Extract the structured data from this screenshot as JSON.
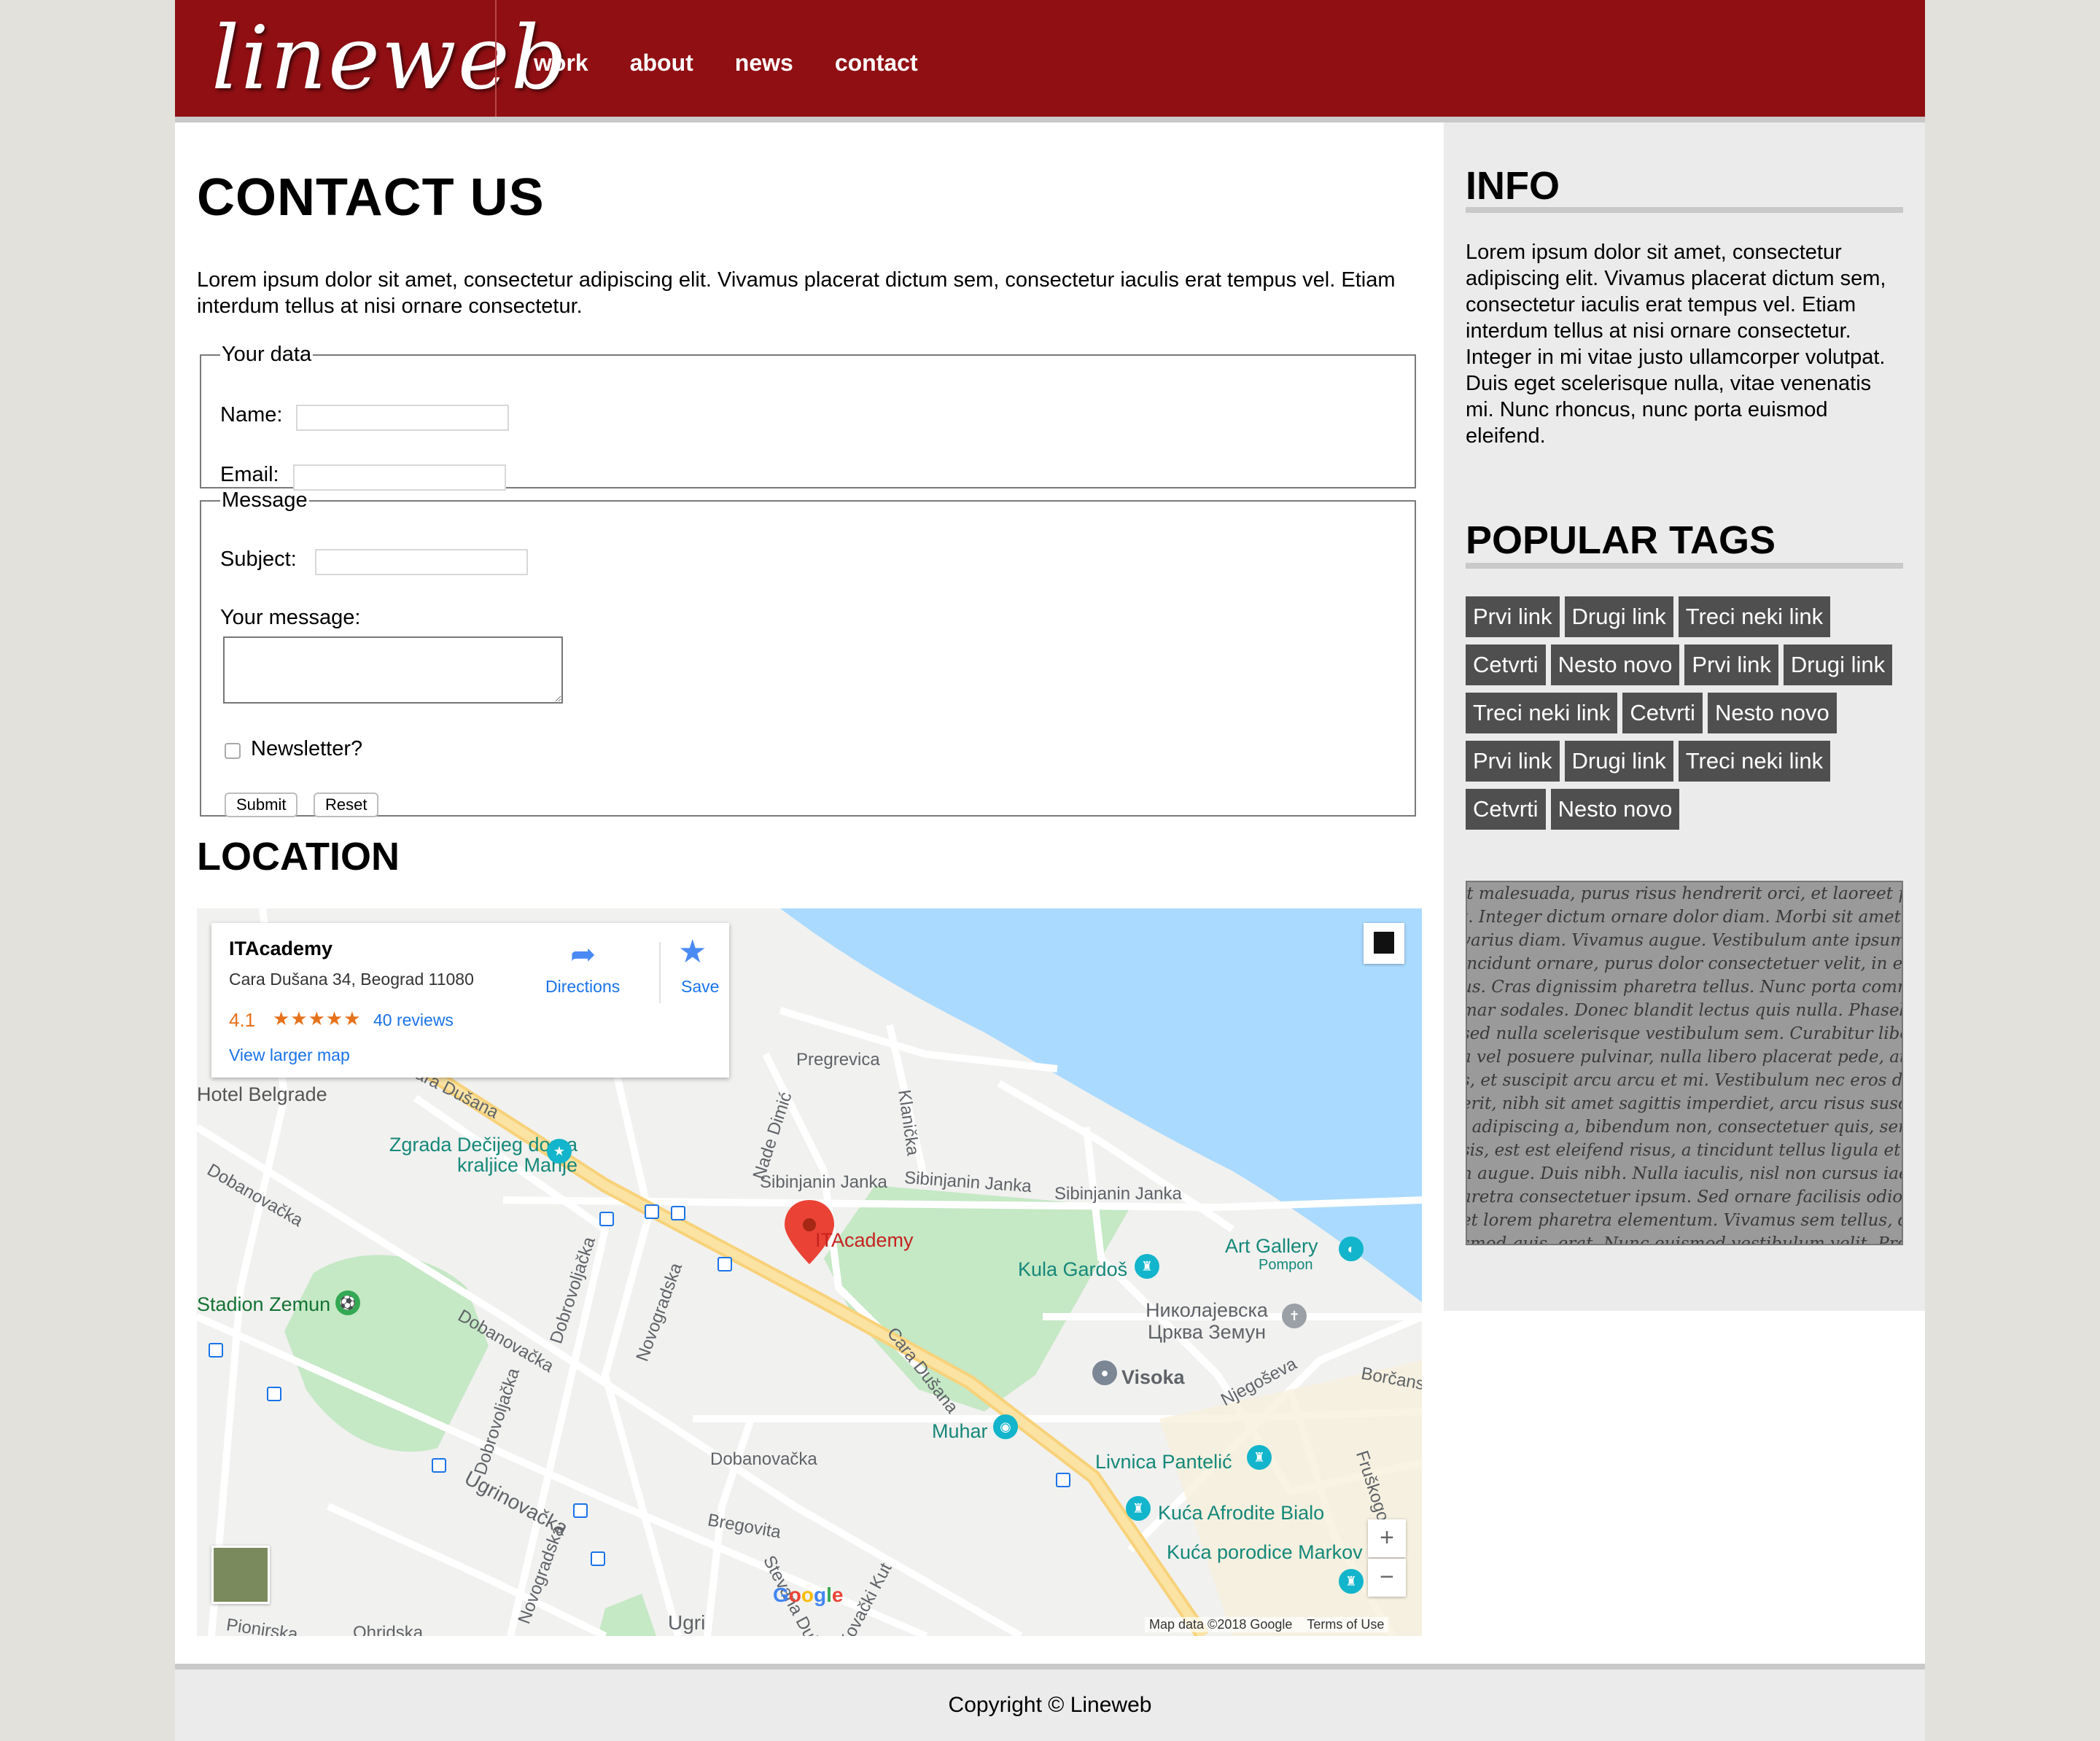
{
  "header": {
    "logo": "lineweb",
    "nav": [
      "work",
      "about",
      "news",
      "contact"
    ],
    "brand_color": "#8f0f13"
  },
  "main": {
    "title": "CONTACT US",
    "intro": "Lorem ipsum dolor sit amet, consectetur adipiscing elit. Vivamus placerat dictum sem, consectetur iaculis erat tempus vel. Etiam interdum tellus at nisi ornare consectetur.",
    "form": {
      "fieldset_data": "Your data",
      "name_label": "Name:",
      "email_label": "Email:",
      "fieldset_message": "Message",
      "subject_label": "Subject:",
      "message_label": "Your message:",
      "newsletter_label": "Newsletter?",
      "newsletter_checked": false,
      "submit_label": "Submit",
      "reset_label": "Reset"
    },
    "location_title": "LOCATION"
  },
  "map": {
    "place_name": "ITAcademy",
    "address": "Cara Dušana 34, Beograd 11080",
    "rating": "4.1",
    "stars": "★★★★★",
    "reviews": "40 reviews",
    "view_larger": "View larger map",
    "directions": "Directions",
    "save": "Save",
    "marker_label": "ITAcademy",
    "streets": [
      "Pregrevica",
      "Cara Dušana",
      "Cara Dušana",
      "Nade Dimić",
      "Klanička",
      "Sibinjanin Janka",
      "Sibinjanin Janka",
      "Sibinjanin Janka",
      "Dobanovačka",
      "Dobanovačka",
      "Dobanovačka",
      "Dobrovoljačka",
      "Dobrovoljačka",
      "Novogradska",
      "Novogradska",
      "Ugrinovačka",
      "Bregovita",
      "Njegoševa",
      "Borčanska",
      "Fruškogorska",
      "Stevana Dukića",
      "Kovački Kut",
      "Pionirska",
      "Ohridska",
      "Ugri"
    ],
    "pois": {
      "hotel": "Hotel Belgrade",
      "zgrada": "Zgrada Dečijeg doma kraljice Marije",
      "stadion": "Stadion Zemun",
      "kula": "Kula Gardoš",
      "gallery": "Art Gallery",
      "gallery_sub": "Pompon",
      "church": "Николајевска Црква Земун",
      "visoka": "Visoka",
      "muhar": "Muhar",
      "livnica": "Livnica Pantelić",
      "afrodite": "Kuća Afrodite Bialo",
      "porodice": "Kuća porodice Markov"
    },
    "google": "Google",
    "attribution": "Map data ©2018 Google",
    "terms": "Terms of Use",
    "zoom_in": "+",
    "zoom_out": "−"
  },
  "sidebar": {
    "info_title": "INFO",
    "info_text": "Lorem ipsum dolor sit amet, consectetur adipiscing elit. Vivamus placerat dictum sem, consectetur iaculis erat tempus vel. Etiam interdum tellus at nisi ornare consectetur. Integer in mi vitae justo ullamcorper volutpat. Duis eget scelerisque nulla, vitae venenatis mi. Nunc rhoncus, nunc porta euismod eleifend.",
    "tags_title": "POPULAR TAGS",
    "tags": [
      "Prvi link",
      "Drugi link",
      "Treci neki link",
      "Cetvrti",
      "Nesto novo",
      "Prvi link",
      "Drugi link",
      "Treci neki link",
      "Cetvrti",
      "Nesto novo",
      "Prvi link",
      "Drugi link",
      "Treci neki link",
      "Cetvrti",
      "Nesto novo"
    ],
    "script_lines": [
      "it malesuada, purus risus hendrerit orci, et laoreet pede en",
      "t. Integer dictum ornare dolor diam. Morbi sit amet arcu r",
      "varius diam. Vivamus augue. Vestibulum ante ipsum pede",
      "incidunt ornare, purus dolor consectetuer velit, in euismod",
      "us. Cras dignissim pharetra tellus. Nunc porta commodo",
      "mar sodales. Donec blandit lectus quis nulla. Phasellus du",
      "sed nulla scelerisque vestibulum sem. Curabitur libero m",
      "a vel posuere pulvinar, nulla libero placerat pede, at con",
      "s, et suscipit arcu arcu et mi. Vestibulum nec eros dictum",
      "erit, nibh sit amet sagittis imperdiet, arcu risus suscipit a",
      ", adipiscing a, bibendum non, consectetuer quis, sem. Proin",
      "sis, est est eleifend risus, a tincidunt tellus ligula et lectus.",
      "n augue. Duis nibh. Nulla iaculis, nisl non cursus iaculis,",
      "aretra consectetuer ipsum. Sed ornare facilisis odio. Cum s",
      "et lorem pharetra elementum. Vivamus sem tellus, dignissi",
      "smod quis, erat. Nunc euismod vestibulum velit. Proin ur"
    ]
  },
  "footer": {
    "copyright": "Copyright © Lineweb"
  }
}
